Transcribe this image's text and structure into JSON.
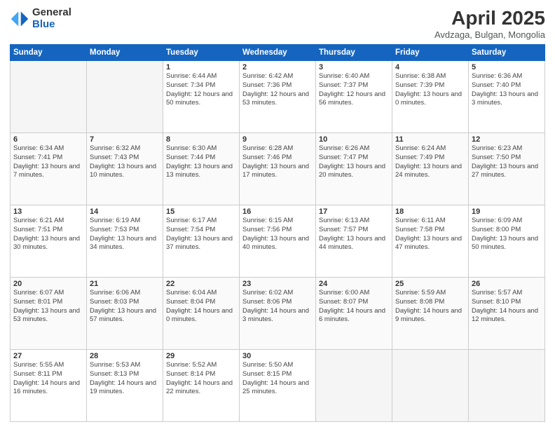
{
  "header": {
    "logo_general": "General",
    "logo_blue": "Blue",
    "month_title": "April 2025",
    "location": "Avdzaga, Bulgan, Mongolia"
  },
  "days_of_week": [
    "Sunday",
    "Monday",
    "Tuesday",
    "Wednesday",
    "Thursday",
    "Friday",
    "Saturday"
  ],
  "weeks": [
    [
      {
        "num": "",
        "empty": true
      },
      {
        "num": "",
        "empty": true
      },
      {
        "num": "1",
        "sunrise": "6:44 AM",
        "sunset": "7:34 PM",
        "daylight": "12 hours and 50 minutes."
      },
      {
        "num": "2",
        "sunrise": "6:42 AM",
        "sunset": "7:36 PM",
        "daylight": "12 hours and 53 minutes."
      },
      {
        "num": "3",
        "sunrise": "6:40 AM",
        "sunset": "7:37 PM",
        "daylight": "12 hours and 56 minutes."
      },
      {
        "num": "4",
        "sunrise": "6:38 AM",
        "sunset": "7:39 PM",
        "daylight": "13 hours and 0 minutes."
      },
      {
        "num": "5",
        "sunrise": "6:36 AM",
        "sunset": "7:40 PM",
        "daylight": "13 hours and 3 minutes."
      }
    ],
    [
      {
        "num": "6",
        "sunrise": "6:34 AM",
        "sunset": "7:41 PM",
        "daylight": "13 hours and 7 minutes."
      },
      {
        "num": "7",
        "sunrise": "6:32 AM",
        "sunset": "7:43 PM",
        "daylight": "13 hours and 10 minutes."
      },
      {
        "num": "8",
        "sunrise": "6:30 AM",
        "sunset": "7:44 PM",
        "daylight": "13 hours and 13 minutes."
      },
      {
        "num": "9",
        "sunrise": "6:28 AM",
        "sunset": "7:46 PM",
        "daylight": "13 hours and 17 minutes."
      },
      {
        "num": "10",
        "sunrise": "6:26 AM",
        "sunset": "7:47 PM",
        "daylight": "13 hours and 20 minutes."
      },
      {
        "num": "11",
        "sunrise": "6:24 AM",
        "sunset": "7:49 PM",
        "daylight": "13 hours and 24 minutes."
      },
      {
        "num": "12",
        "sunrise": "6:23 AM",
        "sunset": "7:50 PM",
        "daylight": "13 hours and 27 minutes."
      }
    ],
    [
      {
        "num": "13",
        "sunrise": "6:21 AM",
        "sunset": "7:51 PM",
        "daylight": "13 hours and 30 minutes."
      },
      {
        "num": "14",
        "sunrise": "6:19 AM",
        "sunset": "7:53 PM",
        "daylight": "13 hours and 34 minutes."
      },
      {
        "num": "15",
        "sunrise": "6:17 AM",
        "sunset": "7:54 PM",
        "daylight": "13 hours and 37 minutes."
      },
      {
        "num": "16",
        "sunrise": "6:15 AM",
        "sunset": "7:56 PM",
        "daylight": "13 hours and 40 minutes."
      },
      {
        "num": "17",
        "sunrise": "6:13 AM",
        "sunset": "7:57 PM",
        "daylight": "13 hours and 44 minutes."
      },
      {
        "num": "18",
        "sunrise": "6:11 AM",
        "sunset": "7:58 PM",
        "daylight": "13 hours and 47 minutes."
      },
      {
        "num": "19",
        "sunrise": "6:09 AM",
        "sunset": "8:00 PM",
        "daylight": "13 hours and 50 minutes."
      }
    ],
    [
      {
        "num": "20",
        "sunrise": "6:07 AM",
        "sunset": "8:01 PM",
        "daylight": "13 hours and 53 minutes."
      },
      {
        "num": "21",
        "sunrise": "6:06 AM",
        "sunset": "8:03 PM",
        "daylight": "13 hours and 57 minutes."
      },
      {
        "num": "22",
        "sunrise": "6:04 AM",
        "sunset": "8:04 PM",
        "daylight": "14 hours and 0 minutes."
      },
      {
        "num": "23",
        "sunrise": "6:02 AM",
        "sunset": "8:06 PM",
        "daylight": "14 hours and 3 minutes."
      },
      {
        "num": "24",
        "sunrise": "6:00 AM",
        "sunset": "8:07 PM",
        "daylight": "14 hours and 6 minutes."
      },
      {
        "num": "25",
        "sunrise": "5:59 AM",
        "sunset": "8:08 PM",
        "daylight": "14 hours and 9 minutes."
      },
      {
        "num": "26",
        "sunrise": "5:57 AM",
        "sunset": "8:10 PM",
        "daylight": "14 hours and 12 minutes."
      }
    ],
    [
      {
        "num": "27",
        "sunrise": "5:55 AM",
        "sunset": "8:11 PM",
        "daylight": "14 hours and 16 minutes."
      },
      {
        "num": "28",
        "sunrise": "5:53 AM",
        "sunset": "8:13 PM",
        "daylight": "14 hours and 19 minutes."
      },
      {
        "num": "29",
        "sunrise": "5:52 AM",
        "sunset": "8:14 PM",
        "daylight": "14 hours and 22 minutes."
      },
      {
        "num": "30",
        "sunrise": "5:50 AM",
        "sunset": "8:15 PM",
        "daylight": "14 hours and 25 minutes."
      },
      {
        "num": "",
        "empty": true
      },
      {
        "num": "",
        "empty": true
      },
      {
        "num": "",
        "empty": true
      }
    ]
  ]
}
